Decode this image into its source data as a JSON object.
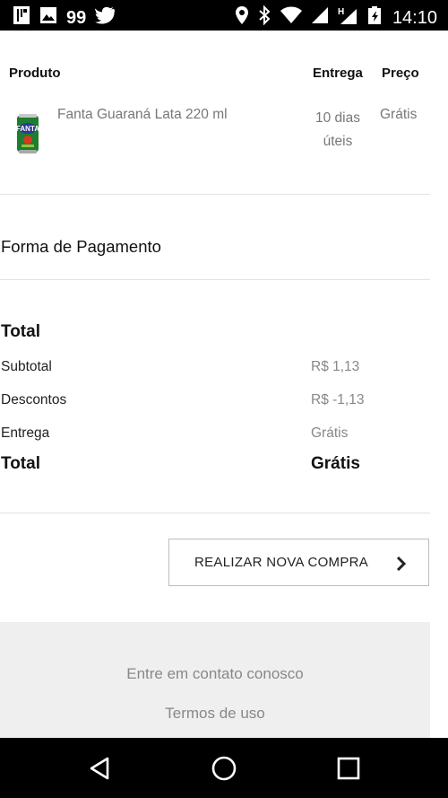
{
  "status_bar": {
    "notification_count": "99",
    "time": "14:10",
    "icons": [
      "sim-card-icon",
      "image-icon",
      "twitter-icon",
      "location-icon",
      "bluetooth-icon",
      "wifi-icon",
      "signal-h-icon",
      "signal-icon",
      "battery-charging-icon"
    ]
  },
  "table": {
    "headers": {
      "product": "Produto",
      "delivery": "Entrega",
      "price": "Preço"
    },
    "item": {
      "name": "Fanta Guaraná Lata 220 ml",
      "delivery_line1": "10 dias",
      "delivery_line2": "úteis",
      "price": "Grátis",
      "image": "fanta-can-image"
    }
  },
  "payment": {
    "title": "Forma de Pagamento"
  },
  "summary": {
    "title": "Total",
    "rows": [
      {
        "label": "Subtotal",
        "value": "R$ 1,13"
      },
      {
        "label": "Descontos",
        "value": "R$ -1,13"
      },
      {
        "label": "Entrega",
        "value": "Grátis"
      }
    ],
    "total_label": "Total",
    "total_value": "Grátis"
  },
  "actions": {
    "new_purchase": "REALIZAR NOVA COMPRA"
  },
  "footer": {
    "contact": "Entre em contato conosco",
    "terms": "Termos de uso"
  },
  "nav_bar": {
    "icons": [
      "back-icon",
      "home-icon",
      "recents-icon"
    ]
  },
  "colors": {
    "status_bar": "#000000",
    "footer_bg": "#efefef",
    "muted_text": "#888888",
    "divider": "#e3e3e3"
  }
}
